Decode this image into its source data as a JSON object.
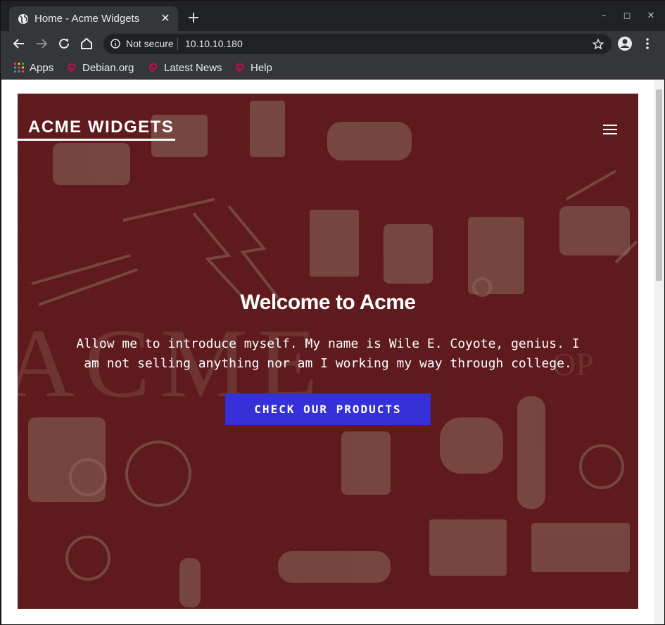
{
  "browser": {
    "tab": {
      "title": "Home - Acme Widgets",
      "close_glyph": "✕"
    },
    "new_tab_glyph": "+",
    "window_controls": {
      "minimize": "–",
      "maximize": "◻",
      "close": "✕"
    },
    "omnibox": {
      "security_label": "Not secure",
      "url": "10.10.10.180"
    },
    "bookmarks": [
      {
        "label": "Apps",
        "icon": "apps-grid-icon"
      },
      {
        "label": "Debian.org",
        "icon": "debian-swirl-icon"
      },
      {
        "label": "Latest News",
        "icon": "debian-swirl-icon"
      },
      {
        "label": "Help",
        "icon": "debian-swirl-icon"
      }
    ]
  },
  "page": {
    "brand": "ACME WIDGETS",
    "hero": {
      "title": "Welcome to Acme",
      "text": "Allow me to introduce myself. My name is Wile E. Coyote, genius. I am not selling anything nor am I working my way through college.",
      "cta": "CHECK OUR PRODUCTS"
    },
    "colors": {
      "hero_background": "#5e1a1c",
      "cta_background": "#3630d8",
      "browser_frame": "#202124",
      "toolbar": "#35363a"
    }
  }
}
